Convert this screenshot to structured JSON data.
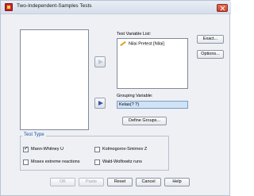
{
  "window": {
    "title": "Two-Independent-Samples Tests"
  },
  "labels": {
    "test_variable_list": "Test Variable List:",
    "grouping_variable": "Grouping Variable:"
  },
  "test_variables": [
    {
      "label": "Nilai Pretest [Nilai]",
      "icon": "scale-variable-icon"
    }
  ],
  "grouping_variable_value": "Kelas(? ?)",
  "buttons": {
    "exact": "Exact...",
    "options": "Options...",
    "define_groups": "Define Groups...",
    "ok": "OK",
    "paste": "Paste",
    "reset": "Reset",
    "cancel": "Cancel",
    "help": "Help"
  },
  "test_type": {
    "title": "Test Type",
    "options": [
      {
        "label": "Mann-Whitney U",
        "checked": true
      },
      {
        "label": "Kolmogorov-Smirnov Z",
        "checked": false
      },
      {
        "label": "Moses extreme reactions",
        "checked": false
      },
      {
        "label": "Wald-Wolfowitz runs",
        "checked": false
      }
    ]
  },
  "colors": {
    "accent": "#2a5ab6",
    "group_title": "#1f4fa3",
    "grouping_field_bg": "#cfe3f7",
    "close_button": "#c7422c"
  }
}
